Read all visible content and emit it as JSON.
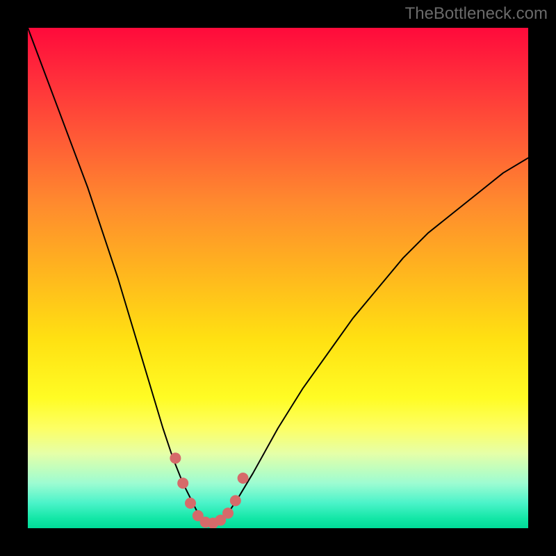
{
  "watermark": "TheBottleneck.com",
  "chart_data": {
    "type": "line",
    "title": "",
    "xlabel": "",
    "ylabel": "",
    "xlim": [
      0,
      100
    ],
    "ylim": [
      0,
      100
    ],
    "x": [
      0,
      3,
      6,
      9,
      12,
      15,
      18,
      21,
      24,
      27,
      29,
      31,
      33,
      34,
      35,
      36,
      37,
      38,
      39,
      40,
      42,
      45,
      50,
      55,
      60,
      65,
      70,
      75,
      80,
      85,
      90,
      95,
      100
    ],
    "series": [
      {
        "name": "bottleneck-curve",
        "values": [
          100,
          92,
          84,
          76,
          68,
          59,
          50,
          40,
          30,
          20,
          14,
          9,
          5,
          3,
          2,
          1.2,
          1,
          1.2,
          1.8,
          3,
          6,
          11,
          20,
          28,
          35,
          42,
          48,
          54,
          59,
          63,
          67,
          71,
          74
        ]
      }
    ],
    "markers": {
      "name": "highlight-band",
      "color": "#d66a6a",
      "x": [
        29.5,
        31,
        32.5,
        34,
        35.5,
        37,
        38.5,
        40,
        41.5,
        43
      ],
      "y": [
        14,
        9,
        5,
        2.5,
        1.2,
        1,
        1.6,
        3,
        5.5,
        10
      ]
    }
  }
}
